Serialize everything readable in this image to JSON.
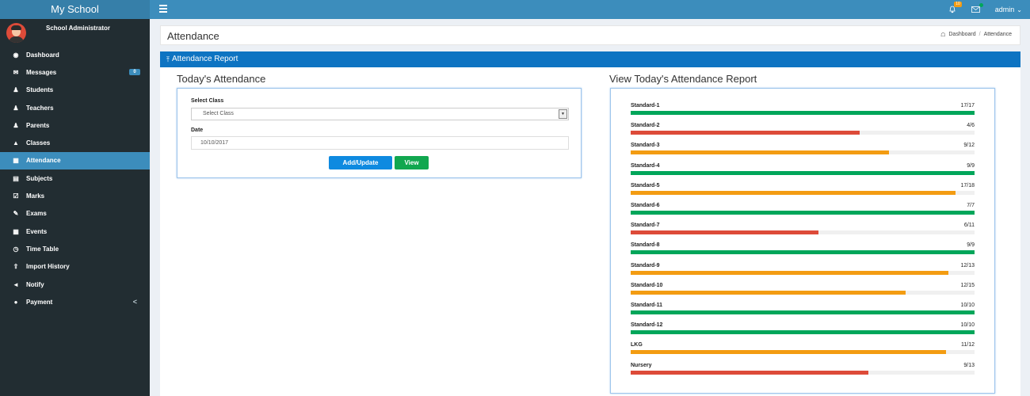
{
  "brand": {
    "title": "My School"
  },
  "topbar": {
    "notif_count": "10",
    "user_label": "admin",
    "user_chevron": "⌄"
  },
  "sidebar": {
    "user_name": "School Administrator",
    "items": [
      {
        "label": "Dashboard",
        "icon": "dashboard-icon",
        "glyph": "◉"
      },
      {
        "label": "Messages",
        "icon": "envelope-icon",
        "glyph": "✉",
        "badge": "0"
      },
      {
        "label": "Students",
        "icon": "users-icon",
        "glyph": "♟"
      },
      {
        "label": "Teachers",
        "icon": "users-icon",
        "glyph": "♟"
      },
      {
        "label": "Parents",
        "icon": "users-icon",
        "glyph": "♟"
      },
      {
        "label": "Classes",
        "icon": "bell-icon",
        "glyph": "▲"
      },
      {
        "label": "Attendance",
        "icon": "table-icon",
        "glyph": "▦",
        "active": true
      },
      {
        "label": "Subjects",
        "icon": "book-icon",
        "glyph": "▤"
      },
      {
        "label": "Marks",
        "icon": "check-square-icon",
        "glyph": "☑"
      },
      {
        "label": "Exams",
        "icon": "edit-icon",
        "glyph": "✎"
      },
      {
        "label": "Events",
        "icon": "calendar-icon",
        "glyph": "▦"
      },
      {
        "label": "Time Table",
        "icon": "clock-icon",
        "glyph": "◷"
      },
      {
        "label": "Import History",
        "icon": "upload-icon",
        "glyph": "⇧"
      },
      {
        "label": "Notify",
        "icon": "bullhorn-icon",
        "glyph": "◄"
      },
      {
        "label": "Payment",
        "icon": "circle-icon",
        "glyph": "●",
        "arrow": "<"
      }
    ]
  },
  "header": {
    "title": "Attendance",
    "breadcrumb": [
      "Dashboard",
      "Attendance"
    ],
    "breadcrumb_sep": "/"
  },
  "box": {
    "title": "Attendance Report"
  },
  "form": {
    "title": "Today's Attendance",
    "class_label": "Select Class",
    "class_value": "Select Class",
    "date_label": "Date",
    "date_value": "10/10/2017",
    "add_button": "Add/Update",
    "view_button": "View"
  },
  "report": {
    "title": "View Today's Attendance Report",
    "colors": {
      "full": "#00a65a",
      "mid": "#f39c12",
      "low": "#dd4b39"
    },
    "rows": [
      {
        "label": "Standard-1",
        "count": "17/17",
        "present": 17,
        "total": 17,
        "status": "full"
      },
      {
        "label": "Standard-2",
        "count": "4/6",
        "present": 4,
        "total": 6,
        "status": "low"
      },
      {
        "label": "Standard-3",
        "count": "9/12",
        "present": 9,
        "total": 12,
        "status": "mid"
      },
      {
        "label": "Standard-4",
        "count": "9/9",
        "present": 9,
        "total": 9,
        "status": "full"
      },
      {
        "label": "Standard-5",
        "count": "17/18",
        "present": 17,
        "total": 18,
        "status": "mid"
      },
      {
        "label": "Standard-6",
        "count": "7/7",
        "present": 7,
        "total": 7,
        "status": "full"
      },
      {
        "label": "Standard-7",
        "count": "6/11",
        "present": 6,
        "total": 11,
        "status": "low"
      },
      {
        "label": "Standard-8",
        "count": "9/9",
        "present": 9,
        "total": 9,
        "status": "full"
      },
      {
        "label": "Standard-9",
        "count": "12/13",
        "present": 12,
        "total": 13,
        "status": "mid"
      },
      {
        "label": "Standard-10",
        "count": "12/15",
        "present": 12,
        "total": 15,
        "status": "mid"
      },
      {
        "label": "Standard-11",
        "count": "10/10",
        "present": 10,
        "total": 10,
        "status": "full"
      },
      {
        "label": "Standard-12",
        "count": "10/10",
        "present": 10,
        "total": 10,
        "status": "full"
      },
      {
        "label": "LKG",
        "count": "11/12",
        "present": 11,
        "total": 12,
        "status": "mid"
      },
      {
        "label": "Nursery",
        "count": "9/13",
        "present": 9,
        "total": 13,
        "status": "low"
      }
    ]
  }
}
